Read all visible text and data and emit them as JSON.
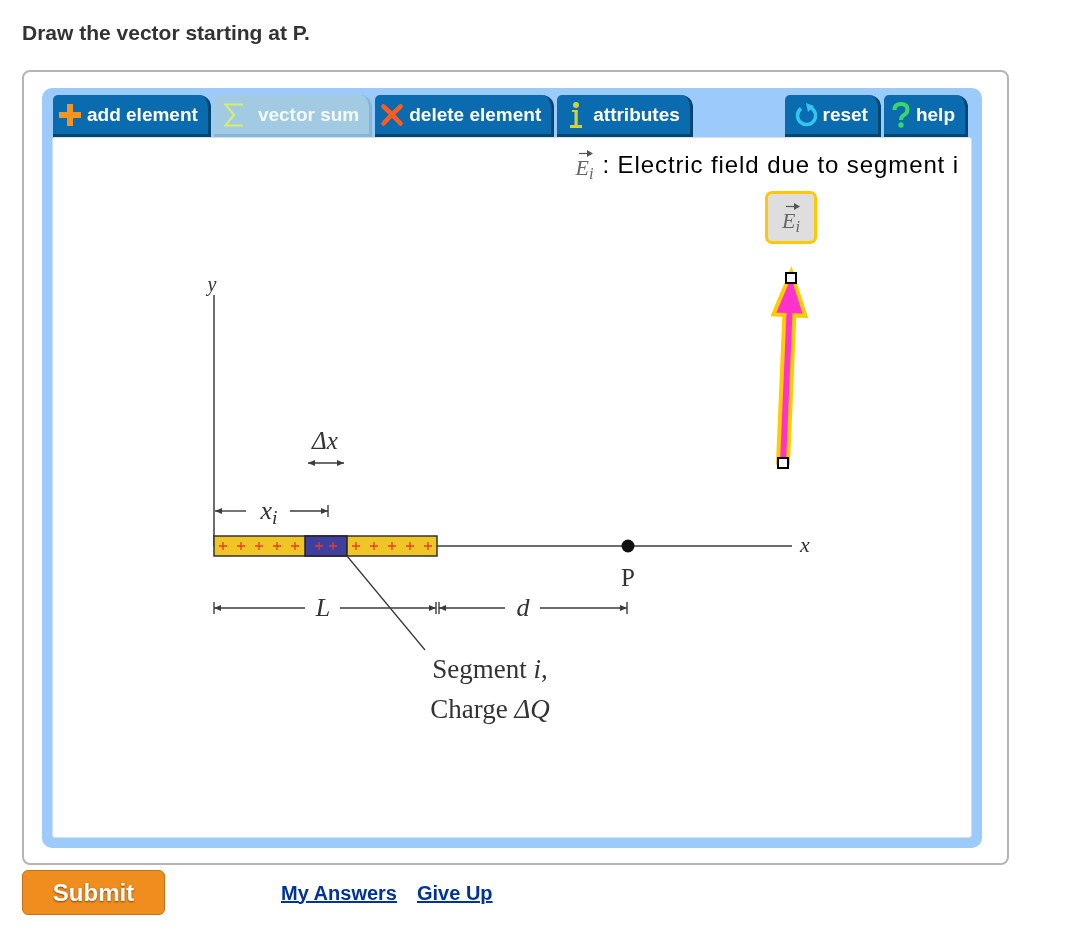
{
  "prompt": "Draw the vector starting at P.",
  "toolbar": {
    "tools": [
      {
        "kind": "add",
        "label": "add element",
        "disabled": false
      },
      {
        "kind": "sum",
        "label": "vector sum",
        "disabled": true
      },
      {
        "kind": "delete",
        "label": "delete element",
        "disabled": false
      },
      {
        "kind": "info",
        "label": "attributes",
        "disabled": false
      }
    ],
    "actions": [
      {
        "kind": "reset",
        "label": "reset"
      },
      {
        "kind": "help",
        "label": "help"
      }
    ]
  },
  "legend": {
    "symbol": "E$_{i}$",
    "text": ": Electric field due to segment i"
  },
  "palette": [
    {
      "symbol": "E$_{i}$",
      "selected": true
    }
  ],
  "diagram": {
    "y_axis_label": "y",
    "x_axis_label": "x",
    "delta_x_label": "Δx",
    "xi_label": "x$_{i}$",
    "length_label": "L",
    "distance_label": "d",
    "point_label": "P",
    "segment_label_lines": [
      "Segment *i*,",
      "Charge *ΔQ*"
    ]
  },
  "vectors": [
    {
      "selected": true
    }
  ],
  "footer": {
    "submit": "Submit",
    "links": [
      "My Answers",
      "Give Up"
    ]
  }
}
